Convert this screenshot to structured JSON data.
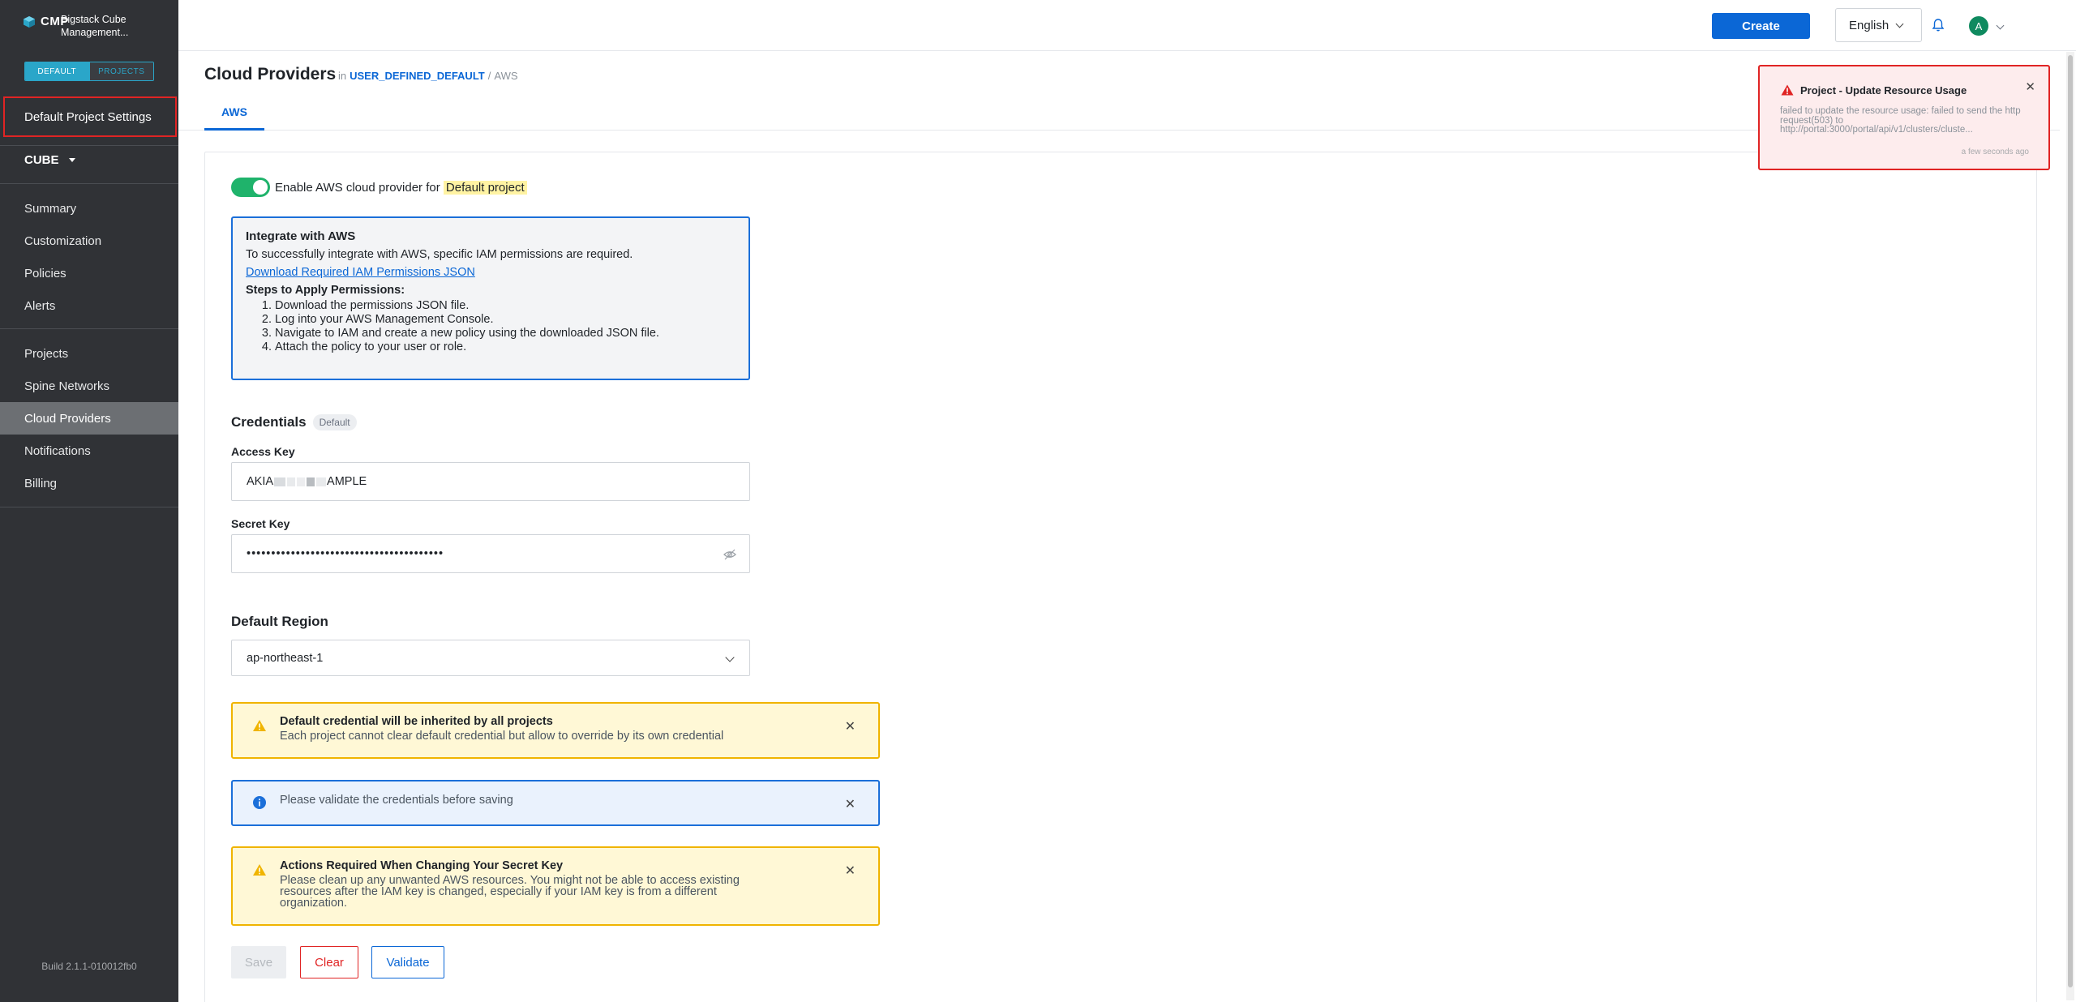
{
  "brand": {
    "logo_text": "CMP",
    "app_name_line1": "Bigstack Cube",
    "app_name_line2": "Management..."
  },
  "mode_toggle": {
    "default_label": "DEFAULT",
    "projects_label": "PROJECTS",
    "active": "DEFAULT"
  },
  "sidebar": {
    "default_settings_label": "Default Project Settings",
    "cube_label": "CUBE",
    "group1": [
      {
        "label": "Summary"
      },
      {
        "label": "Customization"
      },
      {
        "label": "Policies"
      },
      {
        "label": "Alerts"
      }
    ],
    "group2": [
      {
        "label": "Projects"
      },
      {
        "label": "Spine Networks"
      },
      {
        "label": "Cloud Providers",
        "active": true
      },
      {
        "label": "Notifications"
      },
      {
        "label": "Billing"
      }
    ],
    "build": "Build 2.1.1-010012fb0"
  },
  "topbar": {
    "create_label": "Create",
    "language": "English",
    "avatar_initial": "A"
  },
  "header": {
    "title": "Cloud Providers",
    "in_label": "in",
    "scope_link": "USER_DEFINED_DEFAULT",
    "separator": "/",
    "provider": "AWS"
  },
  "tabs": [
    {
      "label": "AWS",
      "active": true
    }
  ],
  "enable": {
    "label_prefix": "Enable AWS cloud provider for",
    "highlight": "Default project",
    "enabled": true
  },
  "integrate": {
    "title": "Integrate with AWS",
    "description": "To successfully integrate with AWS, specific IAM permissions are required.",
    "download_link": "Download Required IAM Permissions JSON",
    "steps_title": "Steps to Apply Permissions:",
    "steps": [
      "Download the permissions JSON file.",
      "Log into your AWS Management Console.",
      "Navigate to IAM and create a new policy using the downloaded JSON file.",
      "Attach the policy to your user or role."
    ]
  },
  "credentials": {
    "title": "Credentials",
    "badge": "Default",
    "access_key_label": "Access Key",
    "access_key_prefix": "AKIA",
    "access_key_suffix": "AMPLE",
    "secret_key_label": "Secret Key",
    "secret_key_value": "••••••••••••••••••••••••••••••••••••••••"
  },
  "region": {
    "title": "Default Region",
    "value": "ap-northeast-1"
  },
  "alerts": [
    {
      "type": "warning",
      "title": "Default credential will be inherited by all projects",
      "body": "Each project cannot clear default credential but allow to override by its own credential"
    },
    {
      "type": "info",
      "title": "",
      "body": "Please validate the credentials before saving"
    },
    {
      "type": "warning",
      "title": "Actions Required When Changing Your Secret Key",
      "body": "Please clean up any unwanted AWS resources. You might not be able to access existing resources after the IAM key is changed, especially if your IAM key is from a different organization."
    }
  ],
  "actions": {
    "save": "Save",
    "clear": "Clear",
    "validate": "Validate"
  },
  "toast": {
    "title": "Project - Update Resource Usage",
    "message": "failed to update the resource usage: failed to send the http request(503) to http://portal:3000/portal/api/v1/clusters/cluste...",
    "time": "a few seconds ago"
  },
  "colors": {
    "primary": "#0b67d6",
    "sidebar_bg": "#303236",
    "success": "#1fb36b",
    "danger": "#e02424",
    "warning": "#f0b400"
  }
}
